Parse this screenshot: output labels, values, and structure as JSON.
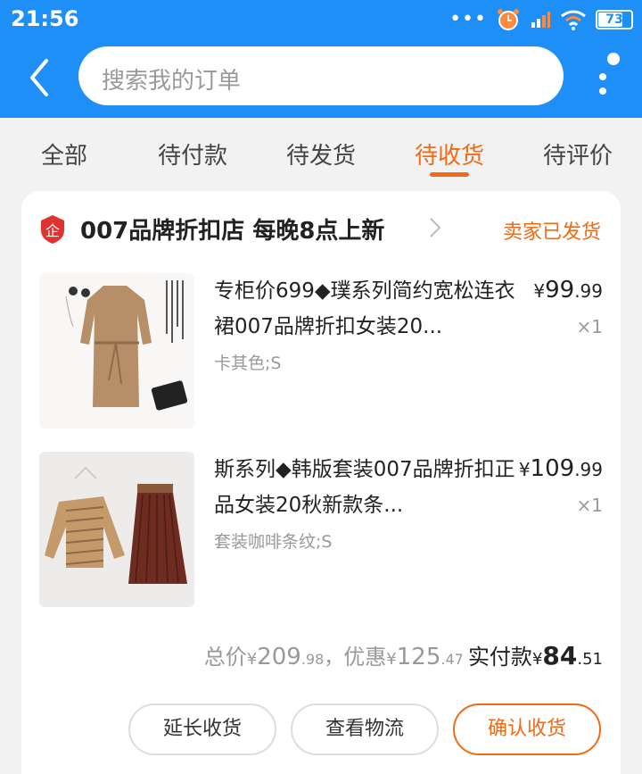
{
  "status_bar": {
    "time": "21:56",
    "battery": "73",
    "icons": [
      "signal-dots-icon",
      "alarm-icon",
      "cellular-icon",
      "wifi-icon",
      "battery-icon"
    ]
  },
  "header": {
    "search_placeholder": "搜索我的订单",
    "icons": [
      "back-arrow-icon",
      "more-dots-icon"
    ]
  },
  "tabs": [
    {
      "label": "全部",
      "active": false
    },
    {
      "label": "待付款",
      "active": false
    },
    {
      "label": "待发货",
      "active": false
    },
    {
      "label": "待收货",
      "active": true
    },
    {
      "label": "待评价",
      "active": false
    }
  ],
  "order": {
    "shop_name": "007品牌折扣店  每晚8点上新",
    "status": "卖家已发货",
    "items": [
      {
        "title": "专柜价699◆璞系列简约宽松连衣裙007品牌折扣女装20...",
        "sku": "卡其色;S",
        "price_symbol": "¥",
        "price_int": "99",
        "price_dec": ".99",
        "qty": "×1"
      },
      {
        "title": "斯系列◆韩版套装007品牌折扣正品女装20秋新款条...",
        "sku": "套装咖啡条纹;S",
        "price_symbol": "¥",
        "price_int": "109",
        "price_dec": ".99",
        "qty": "×1"
      }
    ],
    "totals": {
      "total_label": "总价",
      "total_int": "209",
      "total_dec": ".98",
      "sep": "，",
      "discount_label": "优惠",
      "discount_int": "125",
      "discount_dec": ".47",
      "paid_label": "实付款",
      "paid_int": "84",
      "paid_dec": ".51",
      "symbol": "¥"
    },
    "buttons": {
      "extend": "延长收货",
      "logistics": "查看物流",
      "confirm": "确认收货"
    }
  },
  "colors": {
    "brand_blue": "#1e8ff6",
    "accent_orange": "#ef6b17",
    "shop_logo_red": "#e0322f"
  }
}
